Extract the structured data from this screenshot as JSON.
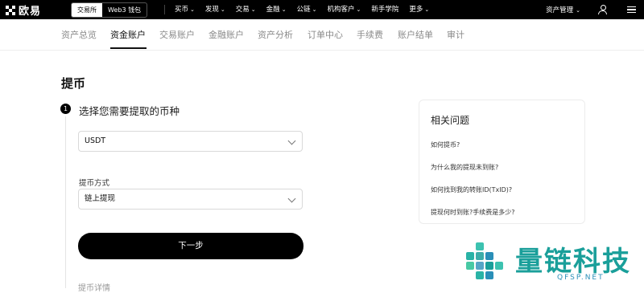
{
  "header": {
    "brand": "欧易",
    "switch": [
      "交易所",
      "Web3 钱包"
    ],
    "nav": [
      {
        "label": "买币",
        "caret": true
      },
      {
        "label": "发现",
        "caret": true
      },
      {
        "label": "交易",
        "caret": true
      },
      {
        "label": "金融",
        "caret": true
      },
      {
        "label": "公链",
        "caret": true
      },
      {
        "label": "机构客户",
        "caret": true
      },
      {
        "label": "新手学院",
        "caret": false
      },
      {
        "label": "更多",
        "caret": true
      }
    ],
    "asset_menu": "资产管理",
    "caret_glyph": "⌄"
  },
  "subtabs": [
    "资产总览",
    "资金账户",
    "交易账户",
    "金融账户",
    "资产分析",
    "订单中心",
    "手续费",
    "账户结单",
    "审计"
  ],
  "active_tab": "资金账户",
  "page_title": "提币",
  "step": {
    "number": "1",
    "title": "选择您需要提取的币种"
  },
  "coin_select": {
    "value": "USDT"
  },
  "method": {
    "label": "提币方式",
    "value": "链上提现"
  },
  "next_button": "下一步",
  "cut_off_text": "提币详情",
  "faq": {
    "title": "相关问题",
    "items": [
      "如何提币?",
      "为什么我的提现未到账?",
      "如何找到我的转账ID(TxID)?",
      "提现何时到账?手续费是多少?"
    ]
  },
  "watermark": {
    "cn": "量链科技",
    "en": "QFSP.NET"
  },
  "colors": {
    "nav_bg": "#000000",
    "watermark_green": "#1a9f9a",
    "watermark_blue": "#2a8fb8"
  }
}
